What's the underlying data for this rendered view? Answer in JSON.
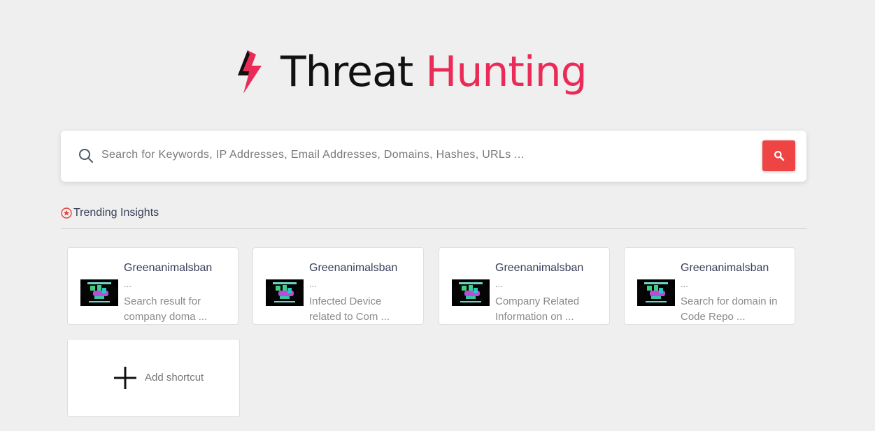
{
  "header": {
    "logo_icon": "lightning-bolt-icon",
    "title_part1": "Threat",
    "title_part2": "Hunting",
    "colors": {
      "dark": "#111111",
      "accent": "#ea2b58"
    }
  },
  "search": {
    "placeholder": "Search for Keywords, IP Addresses, Email Addresses, Domains, Hashes, URLs ...",
    "value": "",
    "button_icon": "search-icon",
    "button_color": "#ee4444"
  },
  "trending": {
    "icon": "star-circle-icon",
    "title": "Trending Insights",
    "cards": [
      {
        "title": "Greenanimalsban",
        "ellipsis": "...",
        "desc": "Search result for company doma ...",
        "thumb": "thumbnail-image"
      },
      {
        "title": "Greenanimalsban",
        "ellipsis": "...",
        "desc": "Infected Device related to Com ...",
        "thumb": "thumbnail-image"
      },
      {
        "title": "Greenanimalsban",
        "ellipsis": "...",
        "desc": "Company Related Information on ...",
        "thumb": "thumbnail-image"
      },
      {
        "title": "Greenanimalsban",
        "ellipsis": "...",
        "desc": "Search for domain in Code Repo ...",
        "thumb": "thumbnail-image"
      }
    ]
  },
  "shortcut": {
    "icon": "plus-icon",
    "label": "Add shortcut"
  }
}
